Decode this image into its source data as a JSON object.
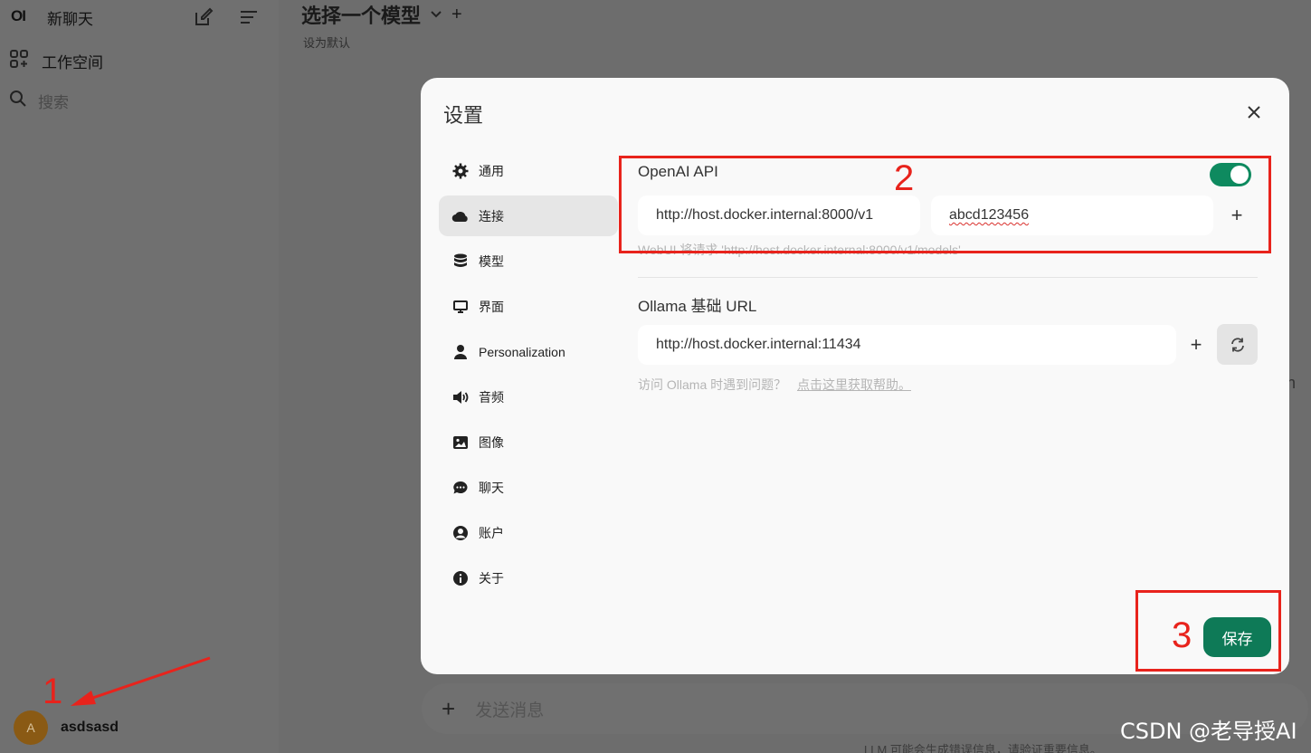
{
  "sidebar": {
    "logo": "OI",
    "new_chat": "新聊天",
    "workspace": "工作空间",
    "search_placeholder": "搜索",
    "user": {
      "avatar_letter": "A",
      "name": "asdsasd"
    }
  },
  "main": {
    "model_selector": "选择一个模型",
    "set_default": "设为默认",
    "composer_placeholder": "发送消息",
    "disclaimer": "LLM 可能会生成错误信息，请验证重要信息。",
    "edge_letter": "n"
  },
  "modal": {
    "title": "设置",
    "nav": [
      {
        "label": "通用",
        "icon": "gear-icon"
      },
      {
        "label": "连接",
        "icon": "cloud-icon"
      },
      {
        "label": "模型",
        "icon": "database-icon"
      },
      {
        "label": "界面",
        "icon": "monitor-icon"
      },
      {
        "label": "Personalization",
        "icon": "user-icon"
      },
      {
        "label": "音频",
        "icon": "speaker-icon"
      },
      {
        "label": "图像",
        "icon": "image-icon"
      },
      {
        "label": "聊天",
        "icon": "chat-icon"
      },
      {
        "label": "账户",
        "icon": "account-icon"
      },
      {
        "label": "关于",
        "icon": "info-icon"
      }
    ],
    "active_nav": "连接",
    "openai": {
      "title": "OpenAI API",
      "enabled": true,
      "url": "http://host.docker.internal:8000/v1",
      "key": "abcd123456",
      "hint": "WebUI 将请求 'http://host.docker.internal:8000/v1/models'"
    },
    "ollama": {
      "title": "Ollama 基础 URL",
      "url": "http://host.docker.internal:11434",
      "hint_text": "访问 Ollama 时遇到问题？",
      "hint_link": "点击这里获取帮助。"
    },
    "save_label": "保存"
  },
  "annotations": {
    "one": "1",
    "two": "2",
    "three": "3",
    "color": "#e8231c"
  },
  "watermark": "CSDN @老导授AI",
  "colors": {
    "accent": "#0e7a57",
    "toggle": "#0e8a5f",
    "overlay": "#6b6b6b"
  }
}
